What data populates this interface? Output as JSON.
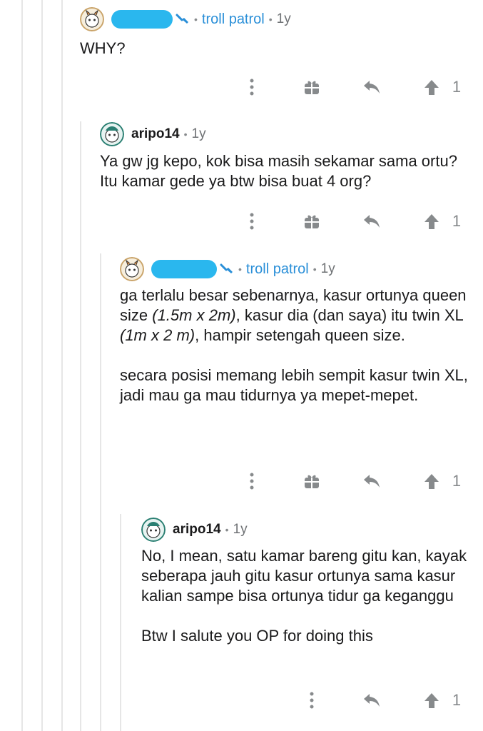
{
  "comments": [
    {
      "username": "",
      "flair": "troll patrol",
      "age": "1y",
      "body": [
        "WHY?"
      ],
      "votes": "1"
    },
    {
      "username": "aripo14",
      "age": "1y",
      "body": [
        "Ya gw jg kepo, kok bisa masih sekamar sama ortu? Itu kamar gede ya btw bisa buat 4 org?"
      ],
      "votes": "1"
    },
    {
      "username": "",
      "flair": "troll patrol",
      "age": "1y",
      "body_parts": {
        "p1a": "ga terlalu besar sebenarnya, kasur ortunya queen size ",
        "p1b": "(1.5m x 2m)",
        "p1c": ", kasur dia (dan saya) itu twin XL ",
        "p1d": "(1m  x 2 m)",
        "p1e": ", hampir setengah queen size.",
        "p2": "secara posisi memang lebih sempit kasur twin XL, jadi mau ga mau tidurnya ya mepet-mepet."
      },
      "votes": "1"
    },
    {
      "username": "aripo14",
      "age": "1y",
      "body": [
        "No, I mean, satu kamar bareng gitu kan, kayak seberapa jauh gitu kasur ortunya sama kasur kalian sampe bisa ortunya tidur ga keganggu",
        "Btw I salute you OP for doing this"
      ],
      "votes": "1"
    }
  ],
  "separator": "•",
  "icons": [
    "more-vertical-icon",
    "award-gift-icon",
    "reply-arrow-icon",
    "upvote-arrow-icon",
    "mod-wrench-icon"
  ],
  "colors": {
    "flair": "#2a8fd8",
    "redaction": "#2ab7ee",
    "icon": "#878a8c",
    "thread_line": "#e6e6e6"
  }
}
